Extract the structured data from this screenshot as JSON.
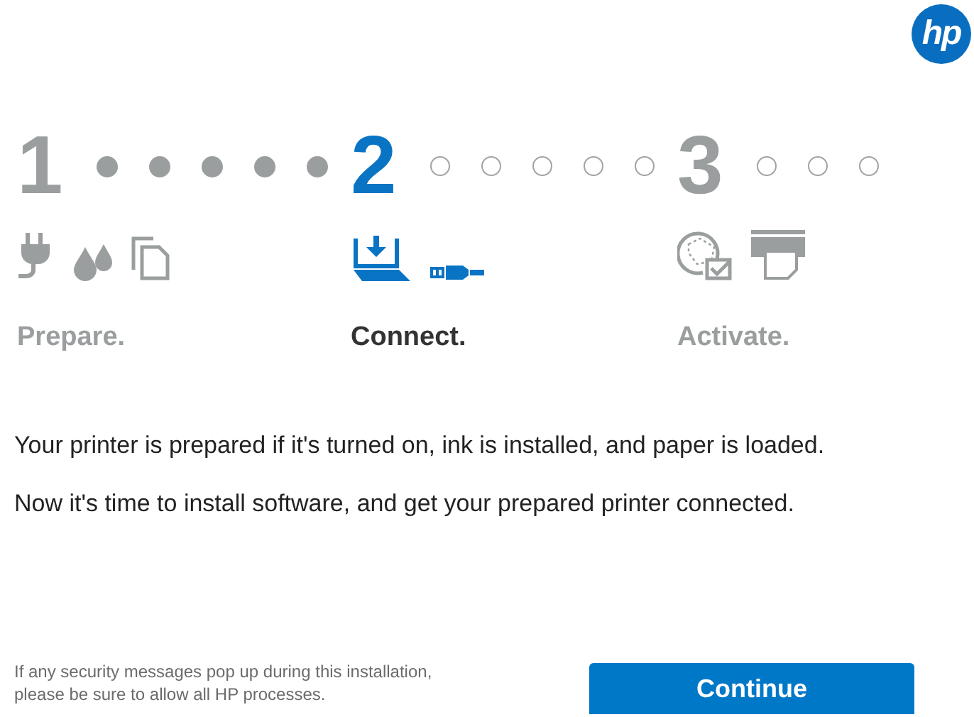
{
  "logo": {
    "text": "hp"
  },
  "steps": [
    {
      "number": "1",
      "label": "Prepare.",
      "selected": false,
      "icons": [
        {
          "kind": "plug"
        },
        {
          "kind": "ink"
        },
        {
          "kind": "paper"
        }
      ],
      "dots": [
        {
          "filled": true
        },
        {
          "filled": true
        },
        {
          "filled": true
        },
        {
          "filled": true
        },
        {
          "filled": true
        }
      ]
    },
    {
      "number": "2",
      "label": "Connect.",
      "selected": true,
      "icons": [
        {
          "kind": "laptop"
        },
        {
          "kind": "usb"
        }
      ],
      "dots": [
        {
          "filled": false
        },
        {
          "filled": false
        },
        {
          "filled": false
        },
        {
          "filled": false
        },
        {
          "filled": false
        }
      ]
    },
    {
      "number": "3",
      "label": "Activate.",
      "selected": false,
      "icons": [
        {
          "kind": "globe"
        },
        {
          "kind": "printer"
        }
      ],
      "dots": [
        {
          "filled": false
        },
        {
          "filled": false
        },
        {
          "filled": false
        }
      ]
    }
  ],
  "paragraphs": [
    "Your printer is prepared if it's turned on, ink is installed, and paper is loaded.",
    "Now it's time to install software, and get your prepared printer connected."
  ],
  "footer_note": "If any security messages pop up during this installation, please be sure to allow all HP processes.",
  "continue_button": "Continue"
}
